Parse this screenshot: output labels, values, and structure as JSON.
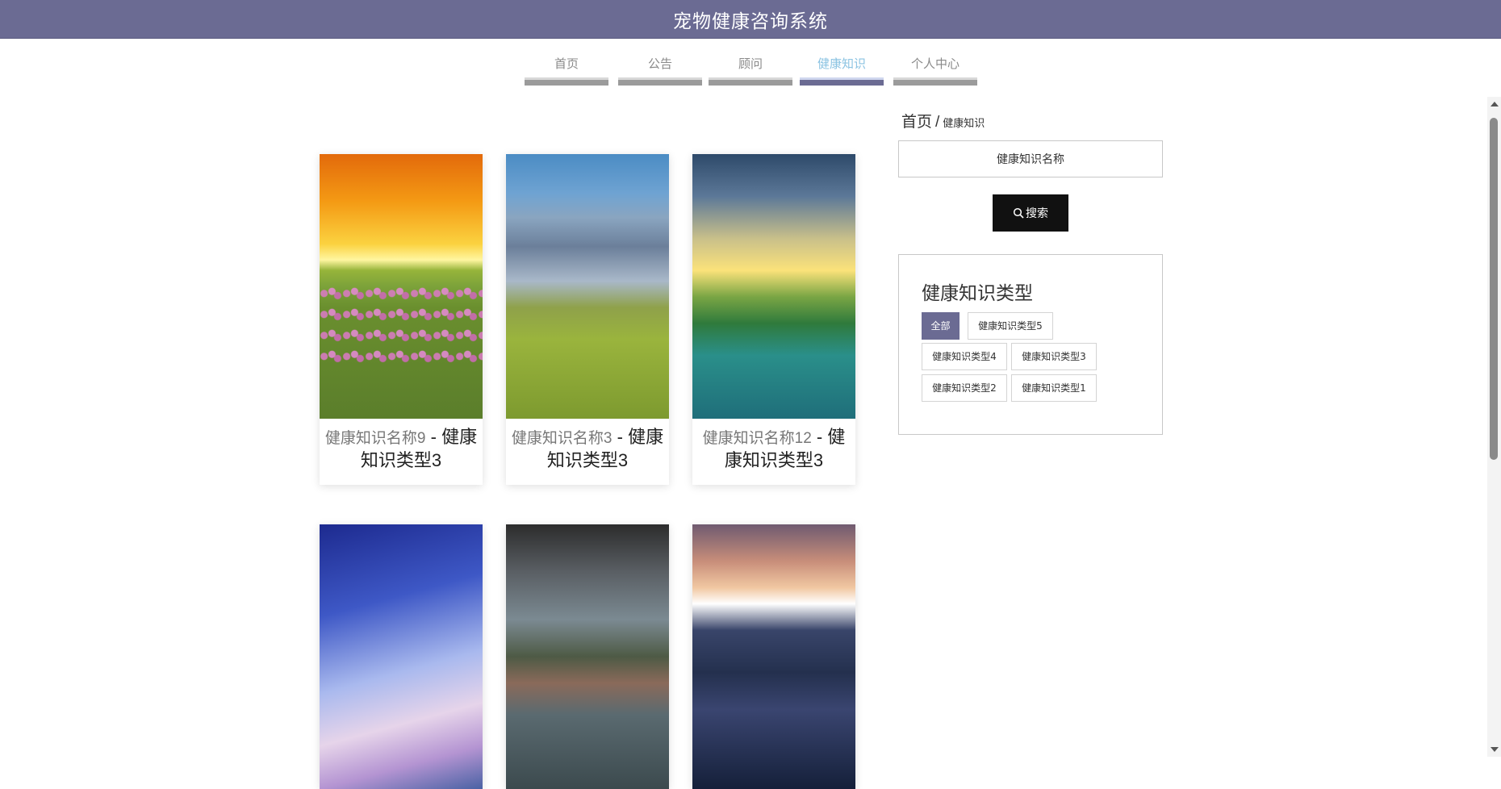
{
  "header": {
    "title": "宠物健康咨询系统"
  },
  "nav": [
    {
      "label": "首页"
    },
    {
      "label": "公告"
    },
    {
      "label": "顾问"
    },
    {
      "label": "健康知识",
      "active": true
    },
    {
      "label": "个人中心"
    }
  ],
  "breadcrumb": {
    "home": "首页",
    "sep": "/",
    "current": "健康知识"
  },
  "search": {
    "placeholder": "健康知识名称",
    "button_label": "搜索",
    "icon": "search-icon"
  },
  "types": {
    "heading": "健康知识类型",
    "tags": [
      "全部",
      "健康知识类型5",
      "健康知识类型4",
      "健康知识类型3",
      "健康知识类型2",
      "健康知识类型1"
    ],
    "active_tag": "全部"
  },
  "cards": [
    {
      "name": "健康知识名称9",
      "sep": " - ",
      "type": "健康知识类型3"
    },
    {
      "name": "健康知识名称3",
      "sep": " - ",
      "type": "健康知识类型3"
    },
    {
      "name": "健康知识名称12",
      "sep": " - ",
      "type": "健康知识类型3"
    },
    {
      "name": "",
      "sep": "",
      "type": ""
    },
    {
      "name": "",
      "sep": "",
      "type": ""
    },
    {
      "name": "",
      "sep": "",
      "type": ""
    }
  ],
  "colors": {
    "brand": "#6b6b93",
    "nav_active_text": "#8bc3e2",
    "button": "#111111"
  }
}
